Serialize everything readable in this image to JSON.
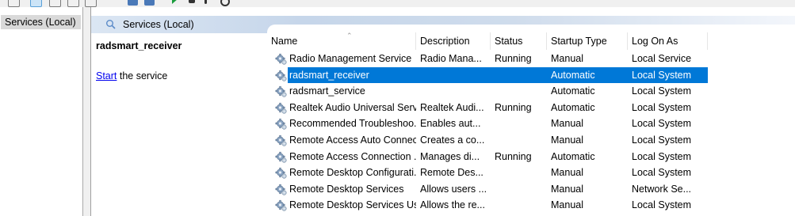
{
  "toolbar": {
    "buttons": [
      "back-icon",
      "console-tree-icon",
      "properties-icon",
      "help-icon",
      "export-icon",
      "mmc-icon",
      "info-icon",
      "play-icon",
      "stop-icon",
      "pause-icon",
      "restart-icon"
    ]
  },
  "tree": {
    "selected_label": "Services (Local)"
  },
  "pane": {
    "title": "Services (Local)"
  },
  "detail": {
    "service_name": "radsmart_receiver",
    "start_link": "Start",
    "start_suffix": " the service"
  },
  "columns": {
    "name": "Name",
    "description": "Description",
    "status": "Status",
    "startup_type": "Startup Type",
    "log_on_as": "Log On As"
  },
  "rows": [
    {
      "name": "Radio Management Service",
      "description": "Radio Mana...",
      "status": "Running",
      "startup": "Manual",
      "logon": "Local Service"
    },
    {
      "name": "radsmart_receiver",
      "description": "",
      "status": "",
      "startup": "Automatic",
      "logon": "Local System"
    },
    {
      "name": "radsmart_service",
      "description": "",
      "status": "",
      "startup": "Automatic",
      "logon": "Local System"
    },
    {
      "name": "Realtek Audio Universal Serv...",
      "description": "Realtek Audi...",
      "status": "Running",
      "startup": "Automatic",
      "logon": "Local System"
    },
    {
      "name": "Recommended Troubleshoo...",
      "description": "Enables aut...",
      "status": "",
      "startup": "Manual",
      "logon": "Local System"
    },
    {
      "name": "Remote Access Auto Connec...",
      "description": "Creates a co...",
      "status": "",
      "startup": "Manual",
      "logon": "Local System"
    },
    {
      "name": "Remote Access Connection ...",
      "description": "Manages di...",
      "status": "Running",
      "startup": "Automatic",
      "logon": "Local System"
    },
    {
      "name": "Remote Desktop Configurati...",
      "description": "Remote Des...",
      "status": "",
      "startup": "Manual",
      "logon": "Local System"
    },
    {
      "name": "Remote Desktop Services",
      "description": "Allows users ...",
      "status": "",
      "startup": "Manual",
      "logon": "Network Se..."
    },
    {
      "name": "Remote Desktop Services Us...",
      "description": "Allows the re...",
      "status": "",
      "startup": "Manual",
      "logon": "Local System"
    }
  ],
  "selected_row": 1,
  "colors": {
    "selection": "#0078d7",
    "link": "#0000ee"
  }
}
